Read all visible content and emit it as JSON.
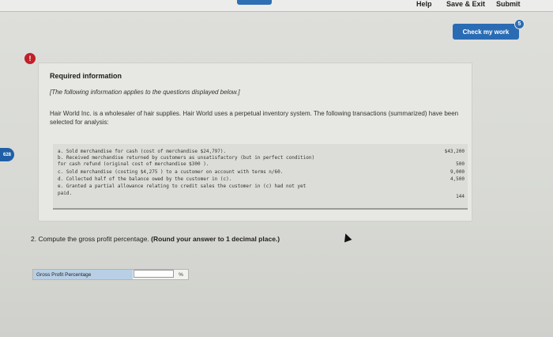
{
  "toolbar": {
    "help_label": "Help",
    "save_exit_label": "Save & Exit",
    "submit_label": "Submit"
  },
  "check": {
    "label": "Check my work",
    "badge": "5"
  },
  "alert": {
    "symbol": "!"
  },
  "side_tab": {
    "label": "628"
  },
  "required": {
    "title": "Required information",
    "subtitle": "[The following information applies to the questions displayed below.]",
    "description": "Hair World Inc. is a wholesaler of hair supplies. Hair World uses a perpetual inventory system. The following transactions (summarized) have been selected for analysis:"
  },
  "transactions": [
    {
      "text": "a. Sold merchandise for cash (cost of merchandise $24,797).",
      "amount": "$43,200"
    },
    {
      "text": "b. Received merchandise returned by customers as unsatisfactory (but in perfect condition)",
      "amount": ""
    },
    {
      "text": "   for cash refund (original cost of merchandise $300 ).",
      "amount": "500"
    },
    {
      "text": "c. Sold merchandise (costing $4,275 ) to a customer on account with terms n/60.",
      "amount": "9,000"
    },
    {
      "text": "d. Collected half of the balance owed by the customer in (c).",
      "amount": "4,500"
    },
    {
      "text": "e. Granted a partial allowance relating to credit sales the customer in (c) had not yet",
      "amount": ""
    },
    {
      "text": "   paid.",
      "amount": "144"
    }
  ],
  "question": {
    "prefix": "2. Compute the gross profit percentage. ",
    "bold": "(Round your answer to 1 decimal place.)"
  },
  "answer": {
    "label": "Gross Profit Percentage",
    "value": "",
    "unit": "%"
  },
  "colors": {
    "primary_blue": "#2a6cb4",
    "alert_red": "#c0202a",
    "label_blue": "#b8cfe6"
  }
}
